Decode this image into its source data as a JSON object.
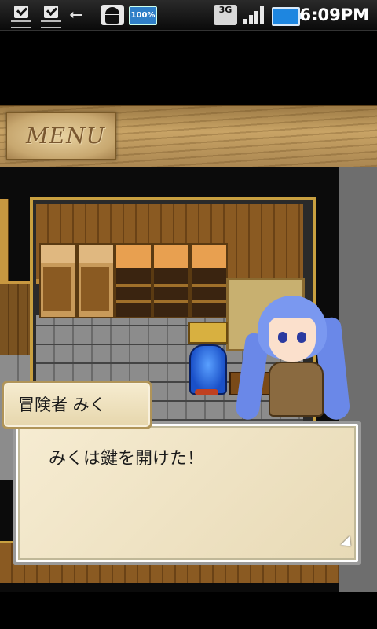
{
  "status_bar": {
    "icons": [
      "notification-check-icon",
      "notification-check-icon",
      "usb-icon",
      "android-debug-icon",
      "battery-100-icon",
      "3g-data-icon",
      "signal-icon",
      "battery-icon"
    ],
    "battery_badge": "100%",
    "network": "3G",
    "time": "6:09PM"
  },
  "menu": {
    "label": "MENU"
  },
  "dialogue": {
    "speaker": "冒険者 みく",
    "message": "みくは鍵を開けた！"
  }
}
